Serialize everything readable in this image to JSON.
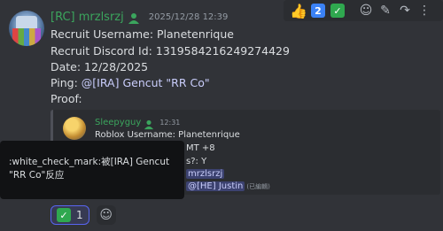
{
  "message": {
    "username": "[RC] mrzlsrzj",
    "timestamp": "2025/12/28 12:39",
    "lines": [
      "Recruit Username: Planetenrique",
      "Recruit Discord Id: 1319584216249274429",
      "Date: 12/28/2025"
    ],
    "ping_label": "Ping:",
    "ping_mention": "@[IRA] Gencut \"RR Co\"",
    "proof_label": "Proof:"
  },
  "toolbar": {
    "thumbs_icon": "thumbs-up-icon",
    "reaction_2": "2",
    "reaction_check": "✓",
    "items": [
      "emoji-icon",
      "pencil-icon",
      "reply-icon",
      "more-icon"
    ]
  },
  "embed": {
    "username": "Sleepyguy",
    "timestamp": "12:31",
    "line1": "Roblox Username: Planetenrique",
    "line2": "MT +8",
    "line3": "s?: Y",
    "line4_mention": "mrzlsrzj",
    "line5_mention": "@[HE] Justin",
    "line5_edited": "(已編輯)"
  },
  "tooltip": {
    "text": ":white_check_mark:被[IRA] Gencut \"RR Co\"反应"
  },
  "reactions": {
    "count": "1",
    "emoji": "✓"
  },
  "colors": {
    "background": "#313338",
    "username_green": "#3ba55d",
    "reaction_border": "#5865f2"
  }
}
